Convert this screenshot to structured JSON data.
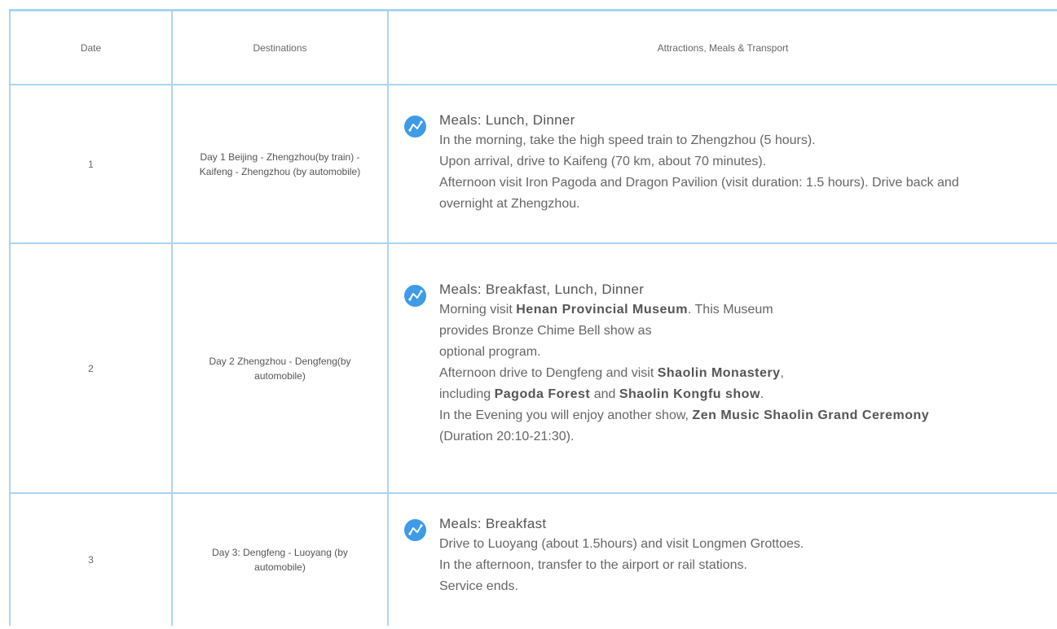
{
  "table": {
    "headers": {
      "date": "Date",
      "destinations": "Destinations",
      "details": "Attractions, Meals & Transport"
    },
    "rows": [
      {
        "date": "1",
        "destination": "Day 1 Beijing - Zhengzhou(by train) - Kaifeng - Zhengzhou (by automobile)",
        "meals": "Meals: Lunch, Dinner",
        "lines": [
          "In the morning, take the high speed train to Zhengzhou (5 hours).",
          "Upon arrival, drive to Kaifeng (70 km, about 70 minutes).",
          "Afternoon visit Iron Pagoda and Dragon Pavilion (visit duration: 1.5 hours). Drive back and overnight at Zhengzhou."
        ]
      },
      {
        "date": "2",
        "destination": "Day 2 Zhengzhou - Dengfeng(by automobile)",
        "meals": "Meals: Breakfast, Lunch, Dinner",
        "line1_pre": "Morning visit ",
        "line1_bold": "Henan Provincial Museum",
        "line1_post": ". This Museum",
        "line2": "provides Bronze Chime Bell show as",
        "line3": "optional program.",
        "line4_pre": "Afternoon drive to Dengfeng and visit ",
        "line4_bold": "Shaolin Monastery",
        "line4_post": ",",
        "line5_pre": "including ",
        "line5_bold1": "Pagoda Forest",
        "line5_mid": " and ",
        "line5_bold2": "Shaolin Kongfu show",
        "line5_post": ".",
        "line6_pre": "In the Evening you will enjoy another show, ",
        "line6_bold": "Zen Music Shaolin Grand Ceremony",
        "line6_post": " (Duration 20:10-21:30)."
      },
      {
        "date": "3",
        "destination": "Day 3: Dengfeng - Luoyang (by automobile)",
        "meals": "Meals: Breakfast",
        "lines": [
          "Drive to Luoyang (about 1.5hours) and visit Longmen Grottoes.",
          "In the afternoon, transfer to the airport or rail stations.",
          "Service ends."
        ]
      }
    ]
  },
  "icons": {
    "route": "route-icon"
  },
  "colors": {
    "border": "#a9d5f4",
    "icon": "#3d9be8"
  }
}
